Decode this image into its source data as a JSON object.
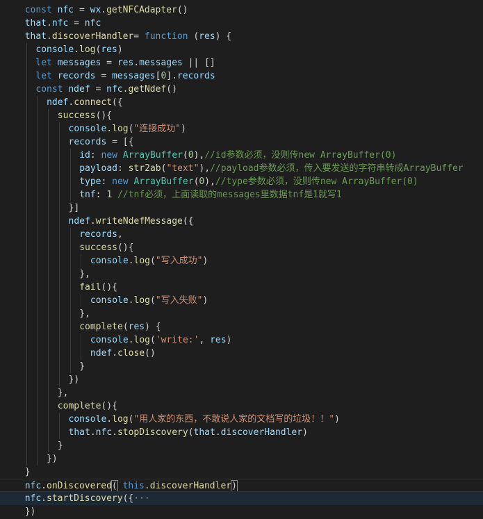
{
  "editor": {
    "lines": [
      {
        "indent": 1,
        "tokens": [
          [
            "kw",
            "const "
          ],
          [
            "var",
            "nfc"
          ],
          [
            "pun",
            " = "
          ],
          [
            "var",
            "wx"
          ],
          [
            "pun",
            "."
          ],
          [
            "fn",
            "getNFCAdapter"
          ],
          [
            "pun",
            "()"
          ]
        ]
      },
      {
        "indent": 1,
        "tokens": [
          [
            "var",
            "that"
          ],
          [
            "pun",
            "."
          ],
          [
            "var",
            "nfc"
          ],
          [
            "pun",
            " = "
          ],
          [
            "var",
            "nfc"
          ]
        ]
      },
      {
        "indent": 1,
        "tokens": [
          [
            "var",
            "that"
          ],
          [
            "pun",
            "."
          ],
          [
            "fn",
            "discoverHandler"
          ],
          [
            "pun",
            "= "
          ],
          [
            "kw",
            "function"
          ],
          [
            "pun",
            " ("
          ],
          [
            "var",
            "res"
          ],
          [
            "pun",
            ") {"
          ]
        ]
      },
      {
        "indent": 2,
        "tokens": [
          [
            "var",
            "console"
          ],
          [
            "pun",
            "."
          ],
          [
            "fn",
            "log"
          ],
          [
            "pun",
            "("
          ],
          [
            "var",
            "res"
          ],
          [
            "pun",
            ")"
          ]
        ]
      },
      {
        "indent": 2,
        "tokens": [
          [
            "kw",
            "let "
          ],
          [
            "var",
            "messages"
          ],
          [
            "pun",
            " = "
          ],
          [
            "var",
            "res"
          ],
          [
            "pun",
            "."
          ],
          [
            "var",
            "messages"
          ],
          [
            "pun",
            " || []"
          ]
        ]
      },
      {
        "indent": 2,
        "tokens": [
          [
            "kw",
            "let "
          ],
          [
            "var",
            "records"
          ],
          [
            "pun",
            " = "
          ],
          [
            "var",
            "messages"
          ],
          [
            "pun",
            "["
          ],
          [
            "num",
            "0"
          ],
          [
            "pun",
            "]."
          ],
          [
            "var",
            "records"
          ]
        ]
      },
      {
        "indent": 2,
        "tokens": [
          [
            "kw",
            "const "
          ],
          [
            "var",
            "ndef"
          ],
          [
            "pun",
            " = "
          ],
          [
            "var",
            "nfc"
          ],
          [
            "pun",
            "."
          ],
          [
            "fn",
            "getNdef"
          ],
          [
            "pun",
            "()"
          ]
        ]
      },
      {
        "indent": 3,
        "tokens": [
          [
            "var",
            "ndef"
          ],
          [
            "pun",
            "."
          ],
          [
            "fn",
            "connect"
          ],
          [
            "pun",
            "({"
          ]
        ]
      },
      {
        "indent": 4,
        "tokens": [
          [
            "fn",
            "success"
          ],
          [
            "pun",
            "(){"
          ]
        ]
      },
      {
        "indent": 5,
        "tokens": [
          [
            "var",
            "console"
          ],
          [
            "pun",
            "."
          ],
          [
            "fn",
            "log"
          ],
          [
            "pun",
            "("
          ],
          [
            "str",
            "\"连接成功\""
          ],
          [
            "pun",
            ")"
          ]
        ]
      },
      {
        "indent": 5,
        "tokens": [
          [
            "var",
            "records"
          ],
          [
            "pun",
            " = [{"
          ]
        ]
      },
      {
        "indent": 6,
        "tokens": [
          [
            "var",
            "id"
          ],
          [
            "pun",
            ": "
          ],
          [
            "kw",
            "new "
          ],
          [
            "cls",
            "ArrayBuffer"
          ],
          [
            "pun",
            "("
          ],
          [
            "num",
            "0"
          ],
          [
            "pun",
            "),"
          ],
          [
            "cmt",
            "//id参数必须，没则传new ArrayBuffer(0)"
          ]
        ]
      },
      {
        "indent": 6,
        "tokens": [
          [
            "var",
            "payload"
          ],
          [
            "pun",
            ": "
          ],
          [
            "fn",
            "str2ab"
          ],
          [
            "pun",
            "("
          ],
          [
            "str",
            "\"text\""
          ],
          [
            "pun",
            "),"
          ],
          [
            "cmt",
            "//payload参数必须，传入要发送的字符串转成ArrayBuffer"
          ]
        ]
      },
      {
        "indent": 6,
        "tokens": [
          [
            "var",
            "type"
          ],
          [
            "pun",
            ": "
          ],
          [
            "kw",
            "new "
          ],
          [
            "cls",
            "ArrayBuffer"
          ],
          [
            "pun",
            "("
          ],
          [
            "num",
            "0"
          ],
          [
            "pun",
            "),"
          ],
          [
            "cmt",
            "//type参数必须，没则传new ArrayBuffer(0)"
          ]
        ]
      },
      {
        "indent": 6,
        "tokens": [
          [
            "var",
            "tnf"
          ],
          [
            "pun",
            ": "
          ],
          [
            "num",
            "1"
          ],
          [
            "pun",
            " "
          ],
          [
            "cmt",
            "//tnf必须，上面读取的messages里数据tnf是1就写1"
          ]
        ]
      },
      {
        "indent": 5,
        "tokens": [
          [
            "pun",
            "}]"
          ]
        ]
      },
      {
        "indent": 5,
        "tokens": [
          [
            "var",
            "ndef"
          ],
          [
            "pun",
            "."
          ],
          [
            "fn",
            "writeNdefMessage"
          ],
          [
            "pun",
            "({"
          ]
        ]
      },
      {
        "indent": 6,
        "tokens": [
          [
            "var",
            "records"
          ],
          [
            "pun",
            ","
          ]
        ]
      },
      {
        "indent": 6,
        "tokens": [
          [
            "fn",
            "success"
          ],
          [
            "pun",
            "(){"
          ]
        ]
      },
      {
        "indent": 7,
        "tokens": [
          [
            "var",
            "console"
          ],
          [
            "pun",
            "."
          ],
          [
            "fn",
            "log"
          ],
          [
            "pun",
            "("
          ],
          [
            "str",
            "\"写入成功\""
          ],
          [
            "pun",
            ")"
          ]
        ]
      },
      {
        "indent": 6,
        "tokens": [
          [
            "pun",
            "},"
          ]
        ]
      },
      {
        "indent": 6,
        "tokens": [
          [
            "fn",
            "fail"
          ],
          [
            "pun",
            "(){"
          ]
        ]
      },
      {
        "indent": 7,
        "tokens": [
          [
            "var",
            "console"
          ],
          [
            "pun",
            "."
          ],
          [
            "fn",
            "log"
          ],
          [
            "pun",
            "("
          ],
          [
            "str",
            "\"写入失败\""
          ],
          [
            "pun",
            ")"
          ]
        ]
      },
      {
        "indent": 6,
        "tokens": [
          [
            "pun",
            "},"
          ]
        ]
      },
      {
        "indent": 6,
        "tokens": [
          [
            "fn",
            "complete"
          ],
          [
            "pun",
            "("
          ],
          [
            "var",
            "res"
          ],
          [
            "pun",
            ") {"
          ]
        ]
      },
      {
        "indent": 7,
        "tokens": [
          [
            "var",
            "console"
          ],
          [
            "pun",
            "."
          ],
          [
            "fn",
            "log"
          ],
          [
            "pun",
            "("
          ],
          [
            "str",
            "'write:'"
          ],
          [
            "pun",
            ", "
          ],
          [
            "var",
            "res"
          ],
          [
            "pun",
            ")"
          ]
        ]
      },
      {
        "indent": 7,
        "tokens": [
          [
            "var",
            "ndef"
          ],
          [
            "pun",
            "."
          ],
          [
            "fn",
            "close"
          ],
          [
            "pun",
            "()"
          ]
        ]
      },
      {
        "indent": 6,
        "tokens": [
          [
            "pun",
            "}"
          ]
        ]
      },
      {
        "indent": 5,
        "tokens": [
          [
            "pun",
            "})"
          ]
        ]
      },
      {
        "indent": 4,
        "tokens": [
          [
            "pun",
            "},"
          ]
        ]
      },
      {
        "indent": 4,
        "tokens": [
          [
            "fn",
            "complete"
          ],
          [
            "pun",
            "(){"
          ]
        ]
      },
      {
        "indent": 5,
        "tokens": [
          [
            "var",
            "console"
          ],
          [
            "pun",
            "."
          ],
          [
            "fn",
            "log"
          ],
          [
            "pun",
            "("
          ],
          [
            "str",
            "\"用人家的东西，不敢说人家的文档写的垃圾！！\""
          ],
          [
            "pun",
            ")"
          ]
        ]
      },
      {
        "indent": 5,
        "tokens": [
          [
            "var",
            "that"
          ],
          [
            "pun",
            "."
          ],
          [
            "var",
            "nfc"
          ],
          [
            "pun",
            "."
          ],
          [
            "fn",
            "stopDiscovery"
          ],
          [
            "pun",
            "("
          ],
          [
            "var",
            "that"
          ],
          [
            "pun",
            "."
          ],
          [
            "var",
            "discoverHandler"
          ],
          [
            "pun",
            ")"
          ]
        ]
      },
      {
        "indent": 4,
        "tokens": [
          [
            "pun",
            "}"
          ]
        ]
      },
      {
        "indent": 3,
        "tokens": [
          [
            "pun",
            "})"
          ]
        ]
      },
      {
        "indent": 1,
        "tokens": [
          [
            "pun",
            "}"
          ]
        ]
      },
      {
        "indent": 1,
        "tokens": [
          [
            "var",
            "nfc"
          ],
          [
            "pun",
            "."
          ],
          [
            "fn",
            "onDiscovered"
          ],
          [
            "brk",
            "("
          ],
          [
            "pun",
            " "
          ],
          [
            "kw",
            "this"
          ],
          [
            "pun",
            "."
          ],
          [
            "fn",
            "discoverHandler"
          ],
          [
            "brk",
            ")"
          ]
        ]
      },
      {
        "indent": 1,
        "tokens": [
          [
            "var",
            "nfc"
          ],
          [
            "pun",
            "."
          ],
          [
            "fn",
            "startDiscovery"
          ],
          [
            "pun",
            "({"
          ],
          [
            "fold",
            "···"
          ]
        ]
      },
      {
        "indent": 1,
        "tokens": [
          [
            "pun",
            "})"
          ]
        ]
      }
    ],
    "highlighted_lines": [
      37
    ],
    "current_line": 36
  }
}
